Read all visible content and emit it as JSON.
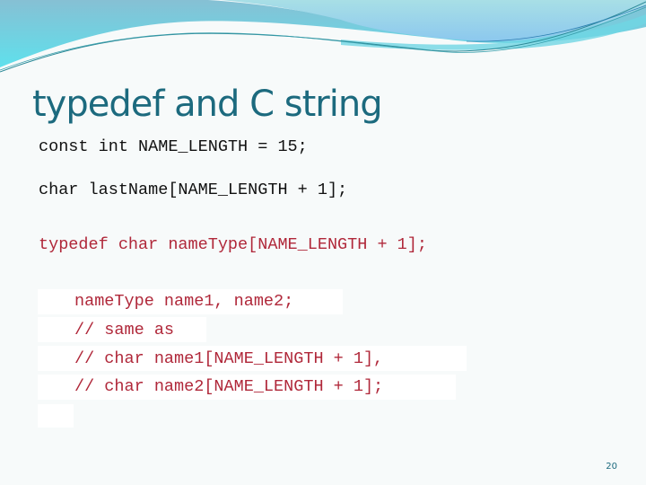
{
  "slide": {
    "title": "typedef and C string",
    "code": {
      "const_line": "const int NAME_LENGTH = 15;",
      "array_line": "char lastName[NAME_LENGTH + 1];",
      "typedef_line": "typedef char nameType[NAME_LENGTH + 1];",
      "block": [
        "nameType name1, name2;",
        "// same as",
        "// char name1[NAME_LENGTH + 1],",
        "// char name2[NAME_LENGTH + 1];"
      ]
    },
    "page_number": "20"
  },
  "colors": {
    "title": "#1c6a7e",
    "code_default": "#111111",
    "code_highlight": "#b0283a",
    "swoosh_dark": "#7fbfd6",
    "swoosh_light": "#a6e0e8"
  }
}
